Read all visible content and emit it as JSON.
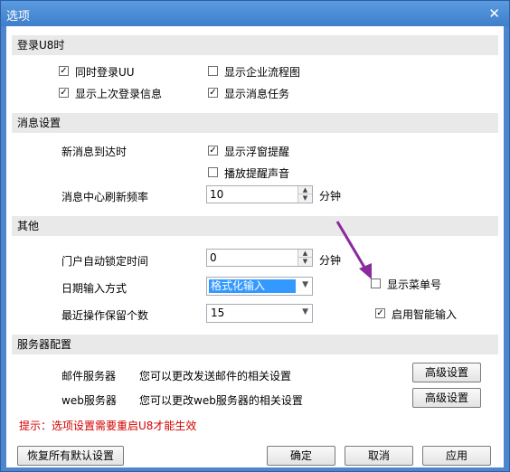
{
  "window": {
    "title": "选项",
    "close_glyph": "✕"
  },
  "login": {
    "header": "登录U8时",
    "options": [
      {
        "label": "同时登录UU",
        "checked": true
      },
      {
        "label": "显示企业流程图",
        "checked": false
      },
      {
        "label": "显示上次登录信息",
        "checked": true
      },
      {
        "label": "显示消息任务",
        "checked": true
      }
    ]
  },
  "message": {
    "header": "消息设置",
    "arrival_label": "新消息到达时",
    "float_popup": {
      "label": "显示浮窗提醒",
      "checked": true
    },
    "play_sound": {
      "label": "播放提醒声音",
      "checked": false
    },
    "refresh_label": "消息中心刷新频率",
    "refresh_value": "10",
    "refresh_unit": "分钟"
  },
  "other": {
    "header": "其他",
    "lock_label": "门户自动锁定时间",
    "lock_value": "0",
    "lock_unit": "分钟",
    "show_menu_no": {
      "label": "显示菜单号",
      "checked": false
    },
    "date_input_label": "日期输入方式",
    "date_input_value": "格式化输入",
    "recent_ops_label": "最近操作保留个数",
    "recent_ops_value": "15",
    "smart_input": {
      "label": "启用智能输入",
      "checked": true
    }
  },
  "server": {
    "header": "服务器配置",
    "mail_label": "邮件服务器",
    "mail_desc": "您可以更改发送邮件的相关设置",
    "web_label": "web服务器",
    "web_desc": "您可以更改web服务器的相关设置",
    "advanced_label": "高级设置"
  },
  "hint": "提示：选项设置需要重启U8才能生效",
  "footer": {
    "restore_label": "恢复所有默认设置",
    "ok_label": "确定",
    "cancel_label": "取消",
    "apply_label": "应用"
  },
  "colors": {
    "title_bar": "#4d86cf",
    "section_bg": "#e9e9e9",
    "hint_red": "#d40000",
    "annotation_arrow": "#8a2a9e"
  }
}
